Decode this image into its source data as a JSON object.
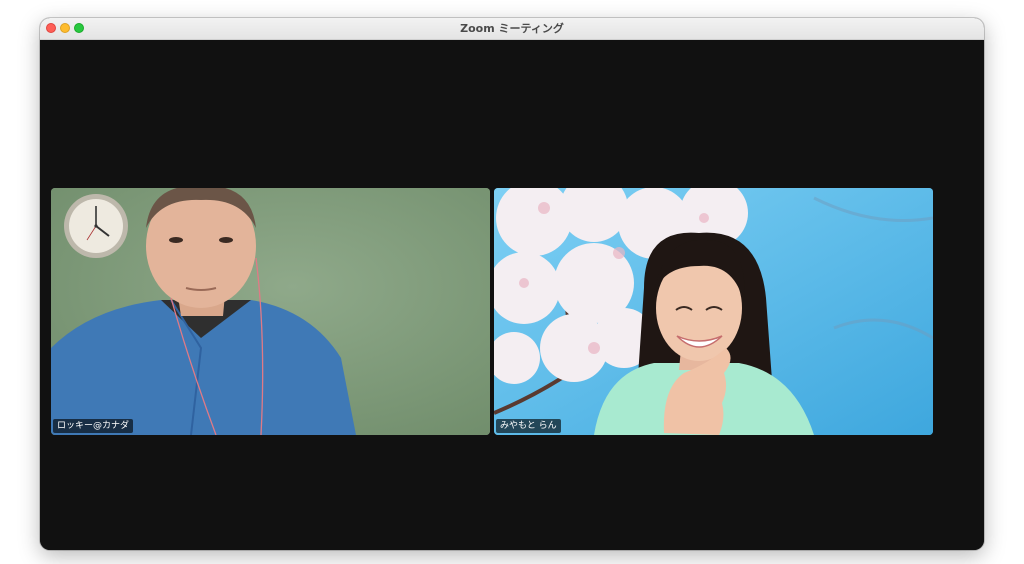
{
  "window": {
    "title": "Zoom ミーティング"
  },
  "participants": [
    {
      "name": "ロッキー@カナダ",
      "video": "on"
    },
    {
      "name": "みやもと らん",
      "video": "on"
    }
  ],
  "colors": {
    "titlebar": "#e8e8e8",
    "stage_background": "#111111",
    "close": "#fe5f57",
    "minimize": "#febc2e",
    "maximize": "#28c840"
  },
  "icons": {
    "close": "close-traffic-light-icon",
    "minimize": "minimize-traffic-light-icon",
    "maximize": "maximize-traffic-light-icon"
  }
}
